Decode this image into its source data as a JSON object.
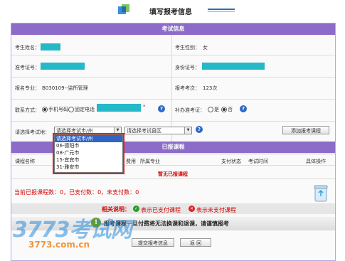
{
  "header": {
    "title": "填写报考信息"
  },
  "exam_info": {
    "section_title": "考试信息",
    "name_label": "考生姓名：",
    "gender_label": "考生性别：",
    "gender_value": "女",
    "ticket_label": "准考证号：",
    "id_label": "身份证号：",
    "major_label": "报名专业：",
    "major_value": "B030109--监所管理",
    "session_label": "报考考次：",
    "session_value": "123次",
    "contact_label": "联系方式：",
    "contact_mobile": "手机号码",
    "contact_landline": "固定电话",
    "required_mark": "*",
    "makeup_label": "补办准考证：",
    "makeup_yes": "是",
    "makeup_no": "否",
    "region_label": "请选择考试地：",
    "city_select": "请选择考试市/州",
    "county_select": "请选择考试县区",
    "add_course_button": "添加报考课程",
    "help_glyph": "?",
    "dropdown_options": [
      "请选择考试市/州",
      "06-德阳市",
      "08-广元市",
      "15-宜宾市",
      "31-雅安市"
    ]
  },
  "registered": {
    "section_title": "已报课程",
    "columns": [
      "课程名称",
      "费用",
      "所属专业",
      "支付状态",
      "考试时间",
      "具体操作"
    ],
    "empty_text": "暂无已报课程",
    "summary": "当前已报课程数：0，已支付数：0，未支付数：0"
  },
  "legend": {
    "title": "相关说明：",
    "paid": "表示已支付课程",
    "unpaid": "表示未支付课程"
  },
  "notice": "报考课程一旦付费将无法换课和退课，请谨慎报考",
  "actions": {
    "submit": "提交报考信息",
    "back": "返 回"
  },
  "watermark": {
    "main": "3773考试网",
    "url": "3773.com.cn"
  }
}
